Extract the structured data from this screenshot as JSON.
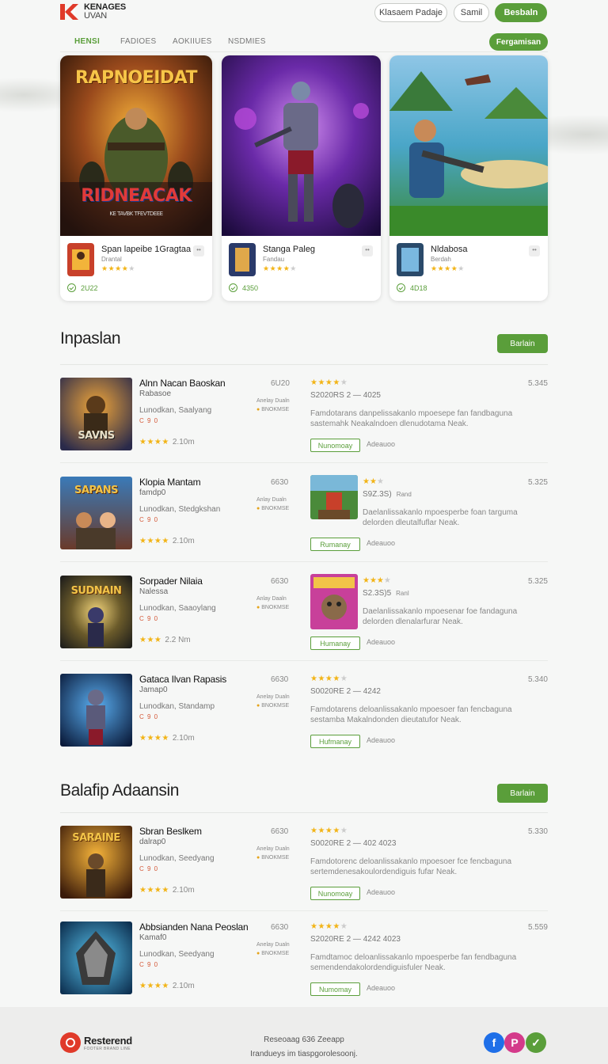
{
  "header": {
    "logo_line1": "KENAGES",
    "logo_line2": "UVAN",
    "buttons": [
      "Klasaem Padaje",
      "Samil",
      "Besbaln"
    ]
  },
  "nav": {
    "items": [
      "HENSI",
      "FADIOES",
      "AOKIIUES",
      "NSDMIES"
    ],
    "action": "Fergamisan"
  },
  "featured": [
    {
      "art_title": "RAPNOEIDAT",
      "art_subtitle": "RIDNEACAK",
      "art_caption": "KE TAVBK TFEVTDEEE",
      "title": "Span lapeibe 1Gragtaa",
      "sub": "Drantal",
      "stars": 4,
      "meta": "2U22"
    },
    {
      "title": "Stanga Paleg",
      "sub": "Fandau",
      "stars": 4,
      "meta": "4350"
    },
    {
      "title": "Nldabosa",
      "sub": "Berdah",
      "stars": 4,
      "meta": "4D18"
    }
  ],
  "sections": [
    {
      "title": "Inpaslan",
      "button": "Barlain",
      "rows": [
        {
          "thumb_label": "SAVNS",
          "title": "Alnn Nacan Baoskan",
          "sub": "Rabasoe",
          "desc": "Lunodkan, Saalyang",
          "red": "C 9 0",
          "stars_text": "★★★★",
          "stars_value": "2.10m",
          "count": "6U20",
          "meta1": "Anelay Dualn",
          "meta2": "BNOKMSE",
          "stars2": 4,
          "date": "S2020RS 2 — 4025",
          "num": "5.345",
          "body": "Famdotarans danpelissakanlo mpoesepe fan fandbaguna sastemahk Neakalndoen dlenudotama Neak.",
          "btn": "Nunomoay",
          "link": "Adeauoo"
        },
        {
          "thumb_label": "SAPANS",
          "title": "Klopia Mantam",
          "sub": "famdp0",
          "desc": "Lunodkan, Stedgkshan",
          "red": "C 9 0",
          "stars_text": "★★★★",
          "stars_value": "2.10m",
          "count": "6630",
          "meta1": "Anlay Dualn",
          "meta2": "BNOKMSE",
          "mini": true,
          "stars2": 3,
          "date": "S9Z.3S)",
          "date_tag": "Rand",
          "num": "5.325",
          "body": "Daelanlissakanlo mpoesperbe foan targuma delorden dleutalfuflar Neak.",
          "btn": "Rumanay",
          "link": "Adeauoo"
        },
        {
          "thumb_label": "SUDNAIN",
          "title": "Sorpader Nilaia",
          "sub": "Nalessa",
          "desc": "Lunodkan, Saaoylang",
          "red": "C 9 0",
          "stars_text": "★★★",
          "stars_value": "2.2 Nm",
          "count": "6630",
          "meta1": "Anlay Daaln",
          "meta2": "BNOKMSE",
          "mini": true,
          "stars2": 4,
          "date": "S2.3S)5",
          "date_tag": "Ranl",
          "num": "5.325",
          "body": "Daelanlissakanlo mpoesenar foe fandaguna delorden dlenalarfurar Neak.",
          "btn": "Humanay",
          "link": "Adeauoo"
        },
        {
          "thumb_label": "",
          "title": "Gataca Ilvan Rapasis",
          "sub": "Jamap0",
          "desc": "Lunodkan, Standamp",
          "red": "C 9 0",
          "stars_text": "★★★★",
          "stars_value": "2.10m",
          "count": "6630",
          "meta1": "Anelay Dualn",
          "meta2": "BNOKMSE",
          "stars2": 4,
          "date": "S0020RE 2 — 4242",
          "num": "5.340",
          "body": "Famdotarens deloanlissakanlo mpoesoer fan fencbaguna sestamba Makalndonden dieutatufor Neak.",
          "btn": "Hufmanay",
          "link": "Adeauoo"
        }
      ]
    },
    {
      "title": "Balafip Adaansin",
      "button": "Barlain",
      "rows": [
        {
          "thumb_label": "SARAINE",
          "title": "Sbran Beslkem",
          "sub": "dalrap0",
          "desc": "Lunodkan, Seedyang",
          "red": "C 9 0",
          "stars_text": "★★★★",
          "stars_value": "2.10m",
          "count": "6630",
          "meta1": "Anelay Dualn",
          "meta2": "BNOKMSE",
          "stars2": 4,
          "date": "S0020RE 2 — 402 4023",
          "num": "5.330",
          "body": "Famdotorenc deloanlissakanlo mpoesoer fce fencbaguna sertemdenesakoulordendiguis fufar Neak.",
          "btn": "Nunomoay",
          "link": "Adeauoo"
        },
        {
          "thumb_label": "",
          "title": "Abbsianden Nana Peoslan",
          "sub": "Kamaf0",
          "desc": "Lunodkan, Seedyang",
          "red": "C 9 0",
          "stars_text": "★★★★",
          "stars_value": "2.10m",
          "count": "6630",
          "meta1": "Anelay Dualn",
          "meta2": "BNOKMSE",
          "stars2": 4,
          "date": "S2020RE 2 — 4242 4023",
          "num": "5.559",
          "body": "Famdtamoc deloanlissakanlo mpoesperbe fan fendbaguna semendendakolordendiguisfuler Neak.",
          "btn": "Numomay",
          "link": "Adeauoo"
        }
      ]
    }
  ],
  "footer": {
    "brand": "Resterend",
    "brand_tag": "FOOTER BRAND LINE",
    "line1": "Reseoaag 636 Zeeapp",
    "line2": "Irandueys im tiaspgorolesoonj.",
    "social": [
      "f",
      "P",
      "✓"
    ]
  },
  "colors": {
    "accent": "#5a9e3a",
    "star": "#f2b417",
    "logo_red": "#e03a2a"
  }
}
